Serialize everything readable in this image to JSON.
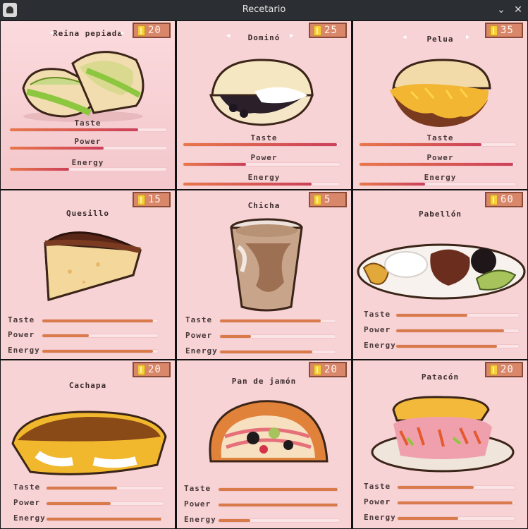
{
  "window": {
    "title": "Recetario"
  },
  "stat_labels": {
    "taste": "Taste",
    "power": "Power",
    "energy": "Energy"
  },
  "recipes": [
    {
      "name": "Reina pepiada",
      "price": "20",
      "has_arrows": true,
      "taste": 0.82,
      "power": 0.6,
      "energy": 0.38
    },
    {
      "name": "Dominó",
      "price": "25",
      "has_arrows": true,
      "taste": 0.98,
      "power": 0.4,
      "energy": 0.82
    },
    {
      "name": "Pelua",
      "price": "35",
      "has_arrows": true,
      "taste": 0.78,
      "power": 0.98,
      "energy": 0.42
    },
    {
      "name": "Quesillo",
      "price": "15",
      "has_arrows": false,
      "taste": 0.96,
      "power": 0.4,
      "energy": 0.96
    },
    {
      "name": "Chicha",
      "price": "5",
      "has_arrows": false,
      "taste": 0.87,
      "power": 0.27,
      "energy": 0.8
    },
    {
      "name": "Pabellón",
      "price": "60",
      "has_arrows": false,
      "taste": 0.58,
      "power": 0.88,
      "energy": 0.82
    },
    {
      "name": "Cachapa",
      "price": "20",
      "has_arrows": false,
      "taste": 0.6,
      "power": 0.55,
      "energy": 0.98
    },
    {
      "name": "Pan de jamón",
      "price": "20",
      "has_arrows": false,
      "taste": 0.98,
      "power": 0.98,
      "energy": 0.26
    },
    {
      "name": "Patacón",
      "price": "20",
      "has_arrows": false,
      "taste": 0.65,
      "power": 0.98,
      "energy": 0.52
    }
  ]
}
